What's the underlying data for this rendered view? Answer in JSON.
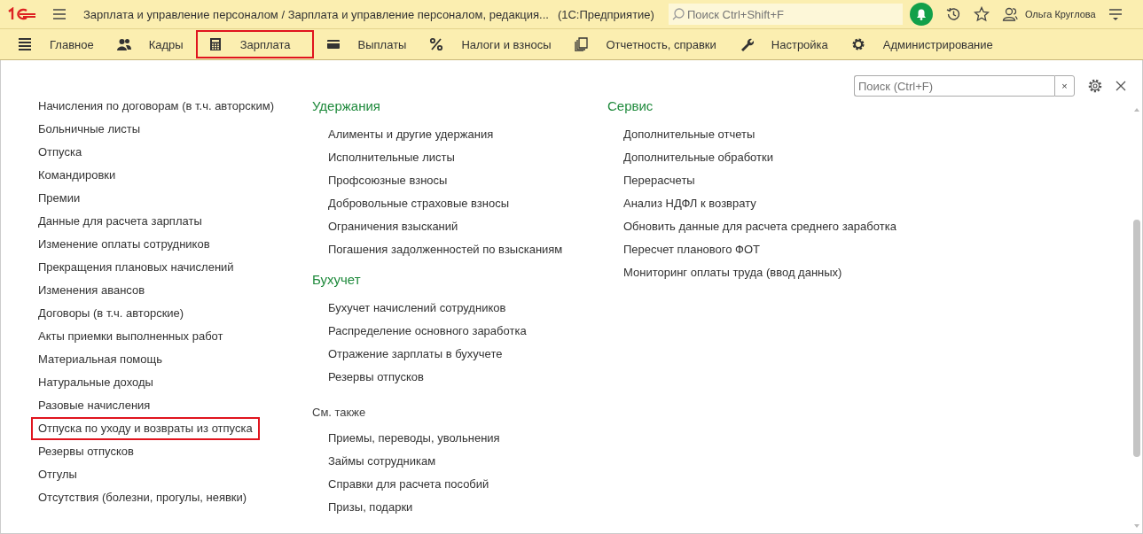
{
  "header": {
    "title": "Зарплата и управление персоналом / Зарплата и управление персоналом, редакция...",
    "app": "(1С:Предприятие)",
    "search_placeholder": "Поиск Ctrl+Shift+F",
    "user": "Ольга Круглова"
  },
  "sections": [
    {
      "label": "Главное",
      "selected": false
    },
    {
      "label": "Кадры",
      "selected": false
    },
    {
      "label": "Зарплата",
      "selected": true
    },
    {
      "label": "Выплаты",
      "selected": false
    },
    {
      "label": "Налоги и взносы",
      "selected": false
    },
    {
      "label": "Отчетность, справки",
      "selected": false
    },
    {
      "label": "Настройка",
      "selected": false
    },
    {
      "label": "Администрирование",
      "selected": false
    }
  ],
  "panel": {
    "search_placeholder": "Поиск (Ctrl+F)",
    "clear": "×"
  },
  "column_1": [
    {
      "label": "Начисления по договорам (в т.ч. авторским)",
      "highlighted": false
    },
    {
      "label": "Больничные листы",
      "highlighted": false
    },
    {
      "label": "Отпуска",
      "highlighted": false
    },
    {
      "label": "Командировки",
      "highlighted": false
    },
    {
      "label": "Премии",
      "highlighted": false
    },
    {
      "label": "Данные для расчета зарплаты",
      "highlighted": false
    },
    {
      "label": "Изменение оплаты сотрудников",
      "highlighted": false
    },
    {
      "label": "Прекращения плановых начислений",
      "highlighted": false
    },
    {
      "label": "Изменения авансов",
      "highlighted": false
    },
    {
      "label": "Договоры (в т.ч. авторские)",
      "highlighted": false
    },
    {
      "label": "Акты приемки выполненных работ",
      "highlighted": false
    },
    {
      "label": "Материальная помощь",
      "highlighted": false
    },
    {
      "label": "Натуральные доходы",
      "highlighted": false
    },
    {
      "label": "Разовые начисления",
      "highlighted": false
    },
    {
      "label": "Отпуска по уходу и возвраты из отпуска",
      "highlighted": true
    },
    {
      "label": "Резервы отпусков",
      "highlighted": false
    },
    {
      "label": "Отгулы",
      "highlighted": false
    },
    {
      "label": "Отсутствия (болезни, прогулы, неявки)",
      "highlighted": false
    }
  ],
  "column_2": [
    {
      "title": "Удержания",
      "kind": "heading",
      "items": [
        "Алименты и другие удержания",
        "Исполнительные листы",
        "Профсоюзные взносы",
        "Добровольные страховые взносы",
        "Ограничения взысканий",
        "Погашения задолженностей по взысканиям"
      ]
    },
    {
      "title": "Бухучет",
      "kind": "heading",
      "items": [
        "Бухучет начислений сотрудников",
        "Распределение основного заработка",
        "Отражение зарплаты в бухучете",
        "Резервы отпусков"
      ]
    },
    {
      "title": "См. также",
      "kind": "see_also",
      "items": [
        "Приемы, переводы, увольнения",
        "Займы сотрудникам",
        "Справки для расчета пособий",
        "Призы, подарки"
      ]
    }
  ],
  "column_3": [
    {
      "title": "Сервис",
      "kind": "heading",
      "items": [
        "Дополнительные отчеты",
        "Дополнительные обработки",
        "Перерасчеты",
        "Анализ НДФЛ к возврату",
        "Обновить данные для расчета среднего заработка",
        "Пересчет планового ФОТ",
        "Мониторинг оплаты труда (ввод данных)"
      ]
    }
  ]
}
